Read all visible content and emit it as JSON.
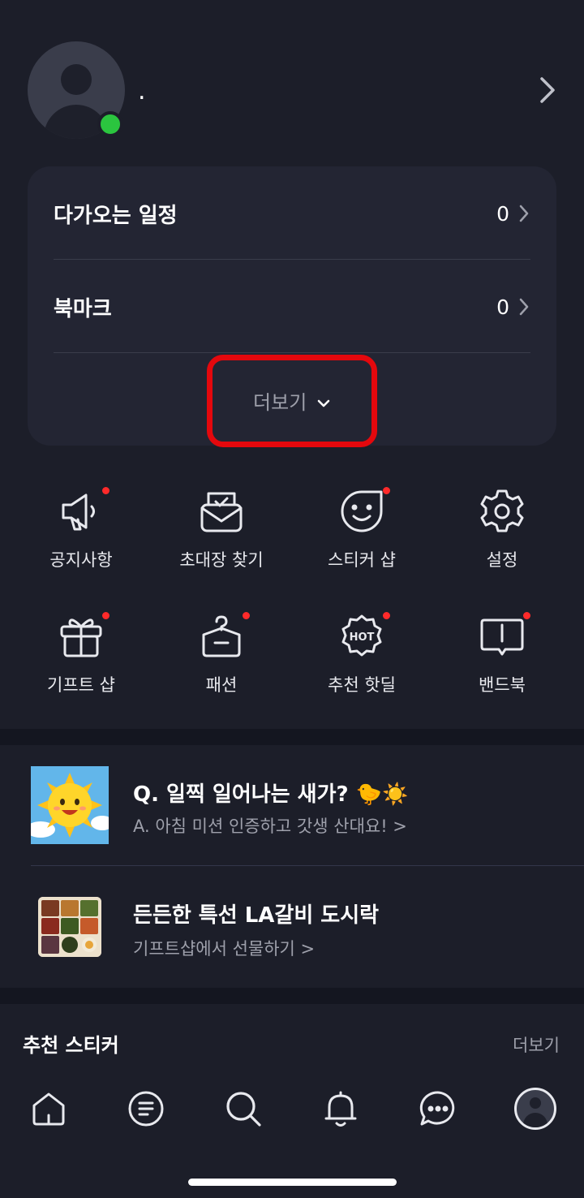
{
  "profile": {
    "name": "."
  },
  "summary": {
    "schedule_label": "다가오는 일정",
    "schedule_count": "0",
    "bookmark_label": "북마크",
    "bookmark_count": "0",
    "more_label": "더보기"
  },
  "menu": [
    {
      "label": "공지사항",
      "icon": "megaphone-icon",
      "badge": true
    },
    {
      "label": "초대장 찾기",
      "icon": "invitation-envelope-icon",
      "badge": false
    },
    {
      "label": "스티커 샵",
      "icon": "smiley-sticker-icon",
      "badge": true
    },
    {
      "label": "설정",
      "icon": "gear-icon",
      "badge": false
    },
    {
      "label": "기프트 샵",
      "icon": "gift-icon",
      "badge": true
    },
    {
      "label": "패션",
      "icon": "clothes-hanger-icon",
      "badge": true
    },
    {
      "label": "추천 핫딜",
      "icon": "hot-badge-icon",
      "badge": true
    },
    {
      "label": "밴드북",
      "icon": "band-book-icon",
      "badge": true
    }
  ],
  "promos": [
    {
      "title": "Q. 일찍 일어나는 새가? 🐤☀️",
      "subtitle": "A.  아침 미션 인증하고 갓생 산대요! >"
    },
    {
      "title": "든든한 특선 LA갈비 도시락",
      "subtitle": "기프트샵에서 선물하기 >"
    }
  ],
  "stickers": {
    "title": "추천 스티커",
    "more_label": "더보기"
  },
  "bottom_nav": [
    "home-icon",
    "feed-icon",
    "search-icon",
    "bell-icon",
    "chat-icon",
    "profile-icon"
  ],
  "colors": {
    "background": "#1c1e29",
    "card": "#232533",
    "online": "#2bc53f",
    "badge": "#ff2a2a",
    "highlight": "#e4080d"
  }
}
